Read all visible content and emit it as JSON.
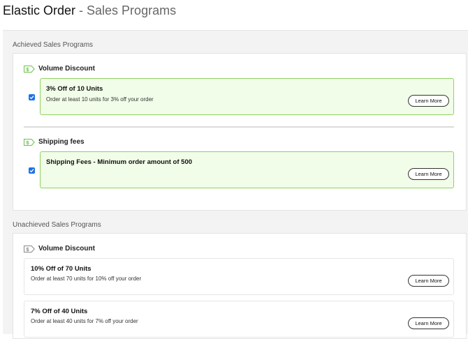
{
  "header": {
    "app": "Elastic Order",
    "subtitle": " - Sales Programs"
  },
  "achieved": {
    "title": "Achieved Sales Programs",
    "groups": [
      {
        "label": "Volume Discount",
        "icon": "price-tag-icon",
        "programs": [
          {
            "title": "3% Off of 10 Units",
            "desc": "Order at least 10 units for 3% off your order",
            "checked": true,
            "button": "Learn More"
          }
        ]
      },
      {
        "label": "Shipping fees",
        "icon": "price-tag-icon",
        "programs": [
          {
            "title": "Shipping Fees - Minimum order amount of 500",
            "desc": "",
            "checked": true,
            "button": "Learn More"
          }
        ]
      }
    ]
  },
  "unachieved": {
    "title": "Unachieved Sales Programs",
    "groups": [
      {
        "label": "Volume Discount",
        "icon": "price-tag-icon",
        "programs": [
          {
            "title": "10% Off of 70 Units",
            "desc": "Order at least 70 units for 10% off your order",
            "button": "Learn More"
          },
          {
            "title": "7% Off of 40 Units",
            "desc": "Order at least 40 units for 7% off your order",
            "button": "Learn More"
          }
        ]
      }
    ]
  },
  "colors": {
    "achieved_border": "#8fd162",
    "achieved_bg": "#f1fde8",
    "checkbox": "#1a73e8",
    "tag_green": "#6cc24a",
    "tag_gray": "#888888"
  }
}
